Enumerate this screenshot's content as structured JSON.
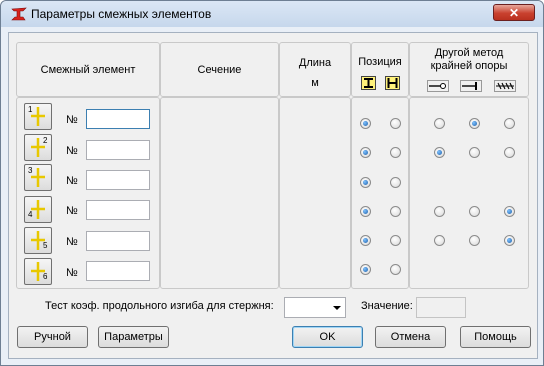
{
  "window": {
    "title": "Параметры смежных элементов",
    "close_symbol": "✕"
  },
  "headers": {
    "adjacent": "Смежный элемент",
    "section": "Сечение",
    "length": "Длина",
    "length_unit": "м",
    "position": "Позиция",
    "other_method_line1": "Другой метод",
    "other_method_line2": "крайней опоры"
  },
  "rows": [
    {
      "button_number": "1",
      "label": "№",
      "value": "",
      "focused": true,
      "position": "left",
      "support": "middle"
    },
    {
      "button_number": "2",
      "label": "№",
      "value": "",
      "focused": false,
      "position": "left",
      "support": "left"
    },
    {
      "button_number": "3",
      "label": "№",
      "value": "",
      "focused": false,
      "position": "left",
      "support": null
    },
    {
      "button_number": "4",
      "label": "№",
      "value": "",
      "focused": false,
      "position": "left",
      "support": "right"
    },
    {
      "button_number": "5",
      "label": "№",
      "value": "",
      "focused": false,
      "position": "left",
      "support": "right"
    },
    {
      "button_number": "6",
      "label": "№",
      "value": "",
      "focused": false,
      "position": "left",
      "support": null
    }
  ],
  "bottom": {
    "test_label": "Тест коэф. продольного изгиба для стержня:",
    "test_value": "",
    "value_label": "Значение:",
    "value": ""
  },
  "buttons": {
    "manual": "Ручной",
    "parameters": "Параметры",
    "ok": "OK",
    "cancel": "Отмена",
    "help": "Помощь"
  },
  "icons": {
    "app": "steel-beam-app-icon",
    "position_options": [
      "i-section-icon",
      "h-section-icon"
    ],
    "support_options": [
      "pinned-end-icon",
      "fixed-end-icon",
      "free-end-icon"
    ]
  },
  "colors": {
    "accent": "#3c7fb1",
    "window_frame": "#c6d7ec",
    "close": "#c9412e"
  }
}
